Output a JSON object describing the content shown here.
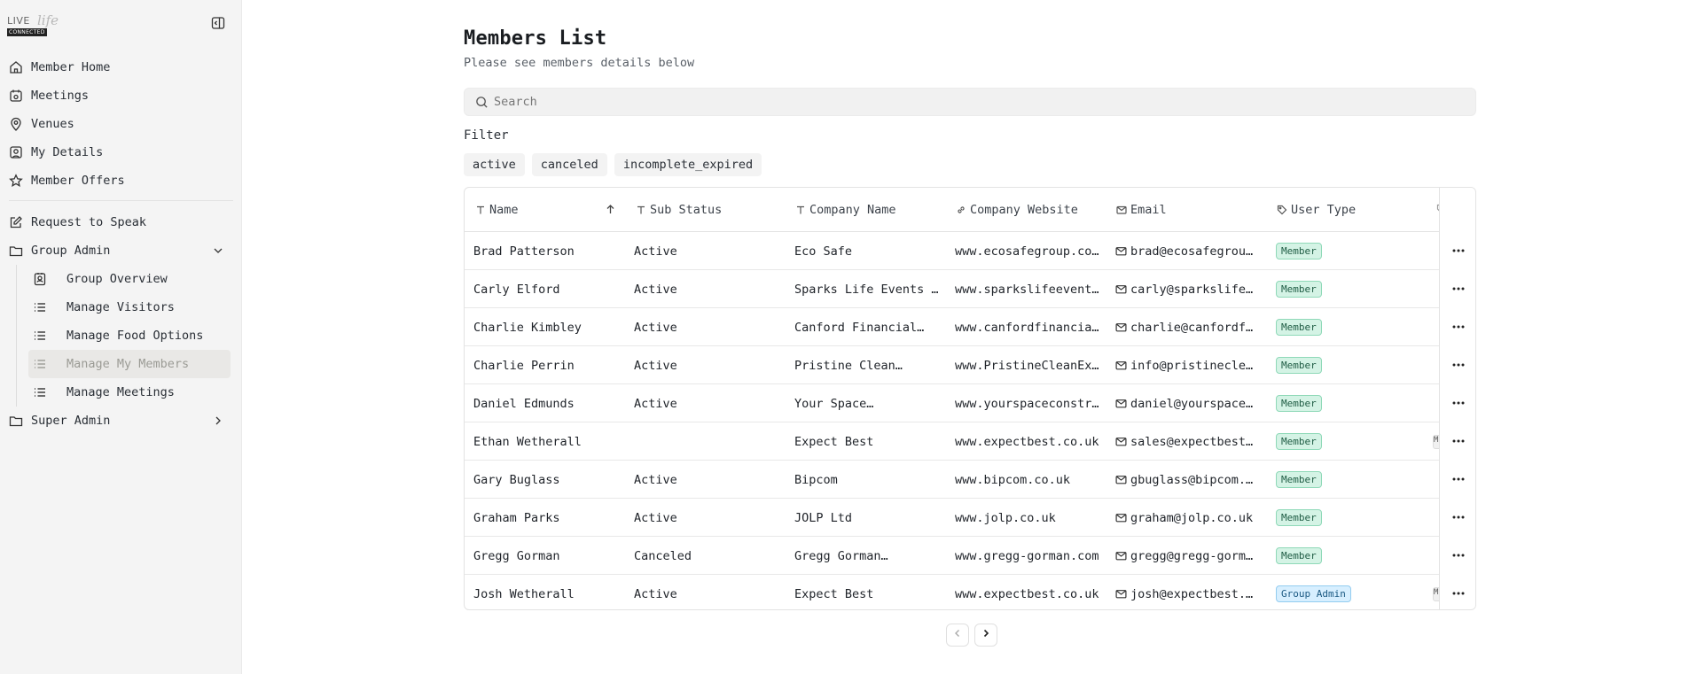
{
  "logo": {
    "word": "LIVE",
    "swirl": "life",
    "tag": "CONNECTED"
  },
  "sidebar": {
    "items": [
      {
        "label": "Member Home",
        "icon": "home-icon"
      },
      {
        "label": "Meetings",
        "icon": "calendar-icon"
      },
      {
        "label": "Venues",
        "icon": "map-pin-icon"
      },
      {
        "label": "My Details",
        "icon": "user-square-icon"
      },
      {
        "label": "Member Offers",
        "icon": "star-icon"
      }
    ],
    "secondary": [
      {
        "label": "Request to Speak",
        "icon": "edit-icon"
      },
      {
        "label": "Group Admin",
        "icon": "folder-icon",
        "expanded": true
      }
    ],
    "group_admin_items": [
      {
        "label": "Group Overview",
        "icon": "contact-icon"
      },
      {
        "label": "Manage Visitors",
        "icon": "list-icon"
      },
      {
        "label": "Manage Food Options",
        "icon": "list-icon"
      },
      {
        "label": "Manage My Members",
        "icon": "list-icon",
        "active": true
      },
      {
        "label": "Manage Meetings",
        "icon": "list-icon"
      }
    ],
    "super_admin": {
      "label": "Super Admin",
      "icon": "folder-icon"
    }
  },
  "page": {
    "title": "Members List",
    "subtitle": "Please see members details below",
    "search_placeholder": "Search",
    "filter_label": "Filter",
    "filters": [
      "active",
      "canceled",
      "incomplete_expired"
    ]
  },
  "table": {
    "columns": [
      "Name",
      "Sub Status",
      "Company Name",
      "Company Website",
      "Email",
      "User Type"
    ],
    "rows": [
      {
        "name": "Brad Patterson",
        "status": "Active",
        "company": "Eco Safe",
        "website": "www.ecosafegroup.co…",
        "email": "brad@ecosafegrou…",
        "type": "Member"
      },
      {
        "name": "Carly Elford",
        "status": "Active",
        "company": "Sparks Life Events …",
        "website": "www.sparkslifeevent…",
        "email": "carly@sparkslife…",
        "type": "Member"
      },
      {
        "name": "Charlie Kimbley",
        "status": "Active",
        "company": "Canford Financial…",
        "website": "www.canfordfinancia…",
        "email": "charlie@canfordf…",
        "type": "Member"
      },
      {
        "name": "Charlie Perrin",
        "status": "Active",
        "company": "Pristine Clean…",
        "website": "www.PristineCleanEx…",
        "email": "info@pristinecle…",
        "type": "Member"
      },
      {
        "name": "Daniel Edmunds",
        "status": "Active",
        "company": "Your Space…",
        "website": "www.yourspaceconstr…",
        "email": "daniel@yourspace…",
        "type": "Member"
      },
      {
        "name": "Ethan Wetherall",
        "status": "",
        "company": "Expect Best",
        "website": "www.expectbest.co.uk",
        "email": "sales@expectbest…",
        "type": "Member",
        "cut": "M"
      },
      {
        "name": "Gary Buglass",
        "status": "Active",
        "company": "Bipcom",
        "website": "www.bipcom.co.uk",
        "email": "gbuglass@bipcom.…",
        "type": "Member"
      },
      {
        "name": "Graham Parks",
        "status": "Active",
        "company": "JOLP Ltd",
        "website": "www.jolp.co.uk",
        "email": "graham@jolp.co.uk",
        "type": "Member"
      },
      {
        "name": "Gregg Gorman",
        "status": "Canceled",
        "company": "Gregg Gorman…",
        "website": "www.gregg-gorman.com",
        "email": "gregg@gregg-gorm…",
        "type": "Member"
      },
      {
        "name": "Josh Wetherall",
        "status": "Active",
        "company": "Expect Best",
        "website": "www.expectbest.co.uk",
        "email": "josh@expectbest.…",
        "type": "Group Admin",
        "cut": "M"
      }
    ]
  }
}
